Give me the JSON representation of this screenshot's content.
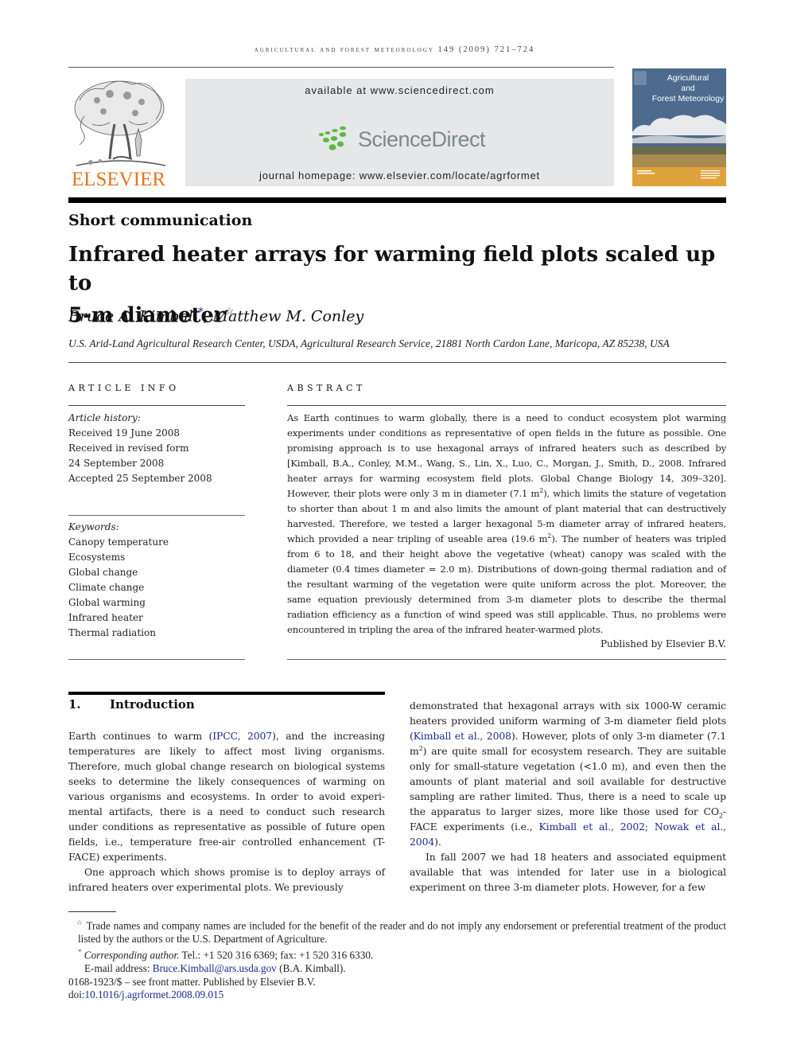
{
  "running_header": "AGRICULTURAL AND FOREST METEOROLOGY 149 (2009) 721–724",
  "masthead": {
    "publisher_logo": "ELSEVIER",
    "publisher_logo_icon": "elsevier-tree-icon",
    "available_at": "available at www.sciencedirect.com",
    "sciencedirect_logo": "ScienceDirect",
    "sciencedirect_icon": "sciencedirect-dots-icon",
    "journal_homepage": "journal homepage: www.elsevier.com/locate/agrformet",
    "cover": {
      "title_line1": "Agricultural",
      "title_line2": "and",
      "title_line3": "Forest Meteorology"
    },
    "colors": {
      "elsevier_orange": "#e8731d",
      "sciencedirect_green": "#5cb846",
      "sciencedirect_gray": "#7d8a86",
      "masthead_box": "#e6e7e8",
      "cover_sky": "#4d6a8f",
      "cover_band": "#e0a23a",
      "link_blue": "#1a2a8c"
    }
  },
  "article": {
    "type": "Short communication",
    "title_line1": "Infrared heater arrays for warming field plots scaled up to",
    "title_line2": "5-m diameter",
    "title_mark": "☆",
    "authors": [
      {
        "name": "Bruce A. Kimball",
        "mark": "*"
      },
      {
        "name": "Matthew M. Conley",
        "mark": ""
      }
    ],
    "author_separator": ",",
    "affiliation": "U.S. Arid-Land Agricultural Research Center, USDA, Agricultural Research Service, 21881 North Cardon Lane, Maricopa, AZ 85238, USA"
  },
  "article_info": {
    "label": "ARTICLE INFO",
    "history_label": "Article history:",
    "history": [
      "Received 19 June 2008",
      "Received in revised form",
      "24 September 2008",
      "Accepted 25 September 2008"
    ],
    "keywords_label": "Keywords:",
    "keywords": [
      "Canopy temperature",
      "Ecosystems",
      "Global change",
      "Climate change",
      "Global warming",
      "Infrared heater",
      "Thermal radiation"
    ]
  },
  "abstract": {
    "label": "ABSTRACT",
    "p1": "As Earth continues to warm globally, there is a need to conduct ecosystem plot warming experiments under conditions as representative of open fields in the future as possible. One promising approach is to use hexagonal arrays of infrared heaters such as described by [Kimball, B.A., Conley, M.M., Wang, S., Lin, X., Luo, C., Morgan, J., Smith, D., 2008. Infrared heater arrays for warming ecosystem field plots. Global Change Biology 14, 309–320]. However, their plots were only 3 m in diameter (7.1 m",
    "p1_sup": "2",
    "p2": "), which limits the stature of vegetation to shorter than about 1 m and also limits the amount of plant material that can destructively harvested. Therefore, we tested a larger hexagonal 5-m diameter array of infrared heaters, which provided a near tripling of useable area (19.6 m",
    "p2_sup": "2",
    "p3": "). The number of heaters was tripled from 6 to 18, and their height above the vegetative (wheat) canopy was scaled with the diameter (0.4 times diameter = 2.0 m). Distributions of down-going thermal radiation and of the resultant warming of the vegetation were quite uniform across the plot. Moreover, the same equation previously determined from 3-m diameter plots to describe the thermal radiation efficiency as a function of wind speed was still applicable. Thus, no problems were encountered in tripling the area of the infrared heater-warmed plots.",
    "publisher_line": "Published by Elsevier B.V."
  },
  "introduction": {
    "number": "1.",
    "heading": "Introduction",
    "left_p1_a": "Earth continues to warm (",
    "left_p1_cite": "IPCC, 2007",
    "left_p1_b": "), and the increasing temperatures are likely to affect most living organisms. Therefore, much global change research on biological systems seeks to determine the likely consequences of warming on various organisms and ecosystems. In order to avoid experi-mental artifacts, there is a need to conduct such research under conditions as representative as possible of future open fields, i.e., temperature free-air controlled enhancement (T-FACE) experiments.",
    "left_p2": "One approach which shows promise is to deploy arrays of infrared heaters over experimental plots. We previously",
    "right_p1_a": "demonstrated that hexagonal arrays with six 1000-W ceramic heaters provided uniform warming of 3-m diameter field plots (",
    "right_p1_cite1": "Kimball et al., 2008",
    "right_p1_b": "). However, plots of only 3-m diameter (7.1 m",
    "right_p1_sup": "2",
    "right_p1_c": ") are quite small for ecosystem research. They are suitable only for small-stature vegetation (<1.0 m), and even then the amounts of plant material and soil available for destructive sampling are rather limited. Thus, there is a need to scale up the apparatus to larger sizes, more like those used for CO",
    "right_p1_sub": "2",
    "right_p1_d": "-FACE experiments (i.e., ",
    "right_p1_cite2": "Kimball et al., 2002; Nowak et al., 2004",
    "right_p1_e": ").",
    "right_p2": "In fall 2007 we had 18 heaters and associated equipment available that was intended for later use in a biological experiment on three 3-m diameter plots. However, for a few"
  },
  "footnotes": {
    "star_mark": "☆",
    "star_note": "Trade names and company names are included for the benefit of the reader and do not imply any endorsement or preferential treatment of the product listed by the authors or the U.S. Department of Agriculture.",
    "corr_mark": "*",
    "corr_label": "Corresponding author.",
    "corr_contact": "Tel.: +1 520 316 6369; fax: +1 520 316 6330.",
    "email_label": "E-mail address:",
    "email": "Bruce.Kimball@ars.usda.gov",
    "email_owner": "(B.A. Kimball).",
    "issn_line": "0168-1923/$ – see front matter. Published by Elsevier B.V.",
    "doi_prefix": "doi:",
    "doi": "10.1016/j.agrformet.2008.09.015"
  }
}
